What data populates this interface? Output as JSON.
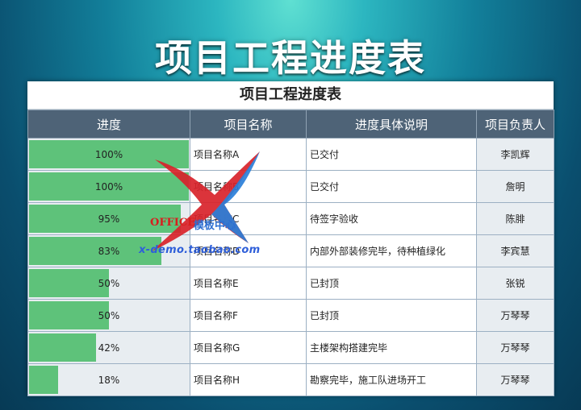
{
  "banner_title": "项目工程进度表",
  "sheet_title": "项目工程进度表",
  "headers": {
    "progress": "进度",
    "name": "项目名称",
    "desc": "进度具体说明",
    "owner": "项目负责人"
  },
  "rows": [
    {
      "progress_label": "100%",
      "progress": 1.0,
      "name": "项目名称A",
      "desc": "已交付",
      "owner": "李凯辉"
    },
    {
      "progress_label": "100%",
      "progress": 1.0,
      "name": "项目名称B",
      "desc": "已交付",
      "owner": "詹明"
    },
    {
      "progress_label": "95%",
      "progress": 0.95,
      "name": "项目名称C",
      "desc": "待签字验收",
      "owner": "陈腓"
    },
    {
      "progress_label": "83%",
      "progress": 0.83,
      "name": "项目名称D",
      "desc": "内部外部装修完毕，待种植绿化",
      "owner": "李宾慧"
    },
    {
      "progress_label": "50%",
      "progress": 0.5,
      "name": "项目名称E",
      "desc": "已封顶",
      "owner": "张锐"
    },
    {
      "progress_label": "50%",
      "progress": 0.5,
      "name": "项目名称F",
      "desc": "已封顶",
      "owner": "万琴琴"
    },
    {
      "progress_label": "42%",
      "progress": 0.42,
      "name": "项目名称G",
      "desc": "主楼架构搭建完毕",
      "owner": "万琴琴"
    },
    {
      "progress_label": "18%",
      "progress": 0.18,
      "name": "项目名称H",
      "desc": "勘察完毕，施工队进场开工",
      "owner": "万琴琴"
    }
  ],
  "watermark": {
    "brand": "OFFICE",
    "brand_cn": "模板中心",
    "url": "x-demo.taobao.com"
  },
  "colors": {
    "bar": "#5ec27a",
    "header_bg": "#4e6377"
  }
}
